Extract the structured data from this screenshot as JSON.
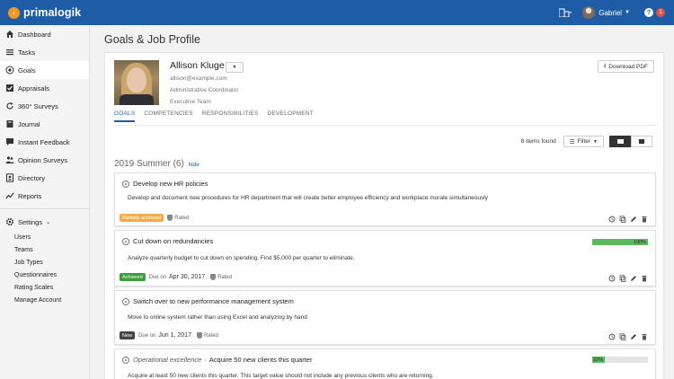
{
  "app": {
    "brand": "primalogik",
    "user": "Gabriel",
    "notif_count": "1",
    "help": "?"
  },
  "sidebar": {
    "items": [
      {
        "label": "Dashboard",
        "icon": "home-icon"
      },
      {
        "label": "Tasks",
        "icon": "list-icon"
      },
      {
        "label": "Goals",
        "icon": "target-icon"
      },
      {
        "label": "Appraisals",
        "icon": "check-icon"
      },
      {
        "label": "360° Surveys",
        "icon": "refresh-icon"
      },
      {
        "label": "Journal",
        "icon": "book-icon"
      },
      {
        "label": "Instant Feedback",
        "icon": "chat-icon"
      },
      {
        "label": "Opinion Surveys",
        "icon": "people-icon"
      },
      {
        "label": "Directory",
        "icon": "contacts-icon"
      },
      {
        "label": "Reports",
        "icon": "chart-icon"
      }
    ],
    "settings_label": "Settings",
    "sub_items": [
      "Users",
      "Teams",
      "Job Types",
      "Questionnaires",
      "Rating Scales",
      "Manage Account"
    ]
  },
  "page": {
    "title": "Goals & Job Profile"
  },
  "profile": {
    "name": "Allison Kluge",
    "email": "allison@example.com",
    "role": "Administrative Coordinator",
    "team": "Executive Team",
    "download_label": "Download PDF"
  },
  "tabs": [
    "GOALS",
    "COMPETENCIES",
    "RESPONSIBILITIES",
    "DEVELOPMENT"
  ],
  "toolbar": {
    "found": "8 items found",
    "filter": "Filter"
  },
  "section": {
    "title": "2019 Summer (6)",
    "hide": "hide"
  },
  "goals": [
    {
      "title": "Develop new HR policies",
      "description": "Develop and document new procedures for HR department that will create better employee efficiency and workplace morale simultaneously",
      "status": "Partially achieved",
      "status_color": "#f0ad4e",
      "rated": "Rated"
    },
    {
      "title": "Cut down on redundancies",
      "description": "Analyze quarterly budget to cut down on spending. Find $5,000 per quarter to eliminate.",
      "status": "Achieved",
      "status_color": "#3c9c3c",
      "due_label": "Due on",
      "due_date": "Apr 30, 2017",
      "rated": "Rated",
      "progress": 100,
      "progress_label": "100%"
    },
    {
      "title": "Switch over to new performance management system",
      "description": "Move to online system rather than using Excel and analyzing by hand",
      "status": "New",
      "status_color": "#444444",
      "due_label": "Due on",
      "due_date": "Jun 1, 2017",
      "rated": "Rated"
    },
    {
      "category": "Operational excellence",
      "separator": "·",
      "title": "Acquire 50 new clients this quarter",
      "description": "Acquire at least 50 new clients this quarter. This target value should not include any previous clients who are returning.",
      "progress": 22,
      "progress_label": "22%"
    }
  ]
}
